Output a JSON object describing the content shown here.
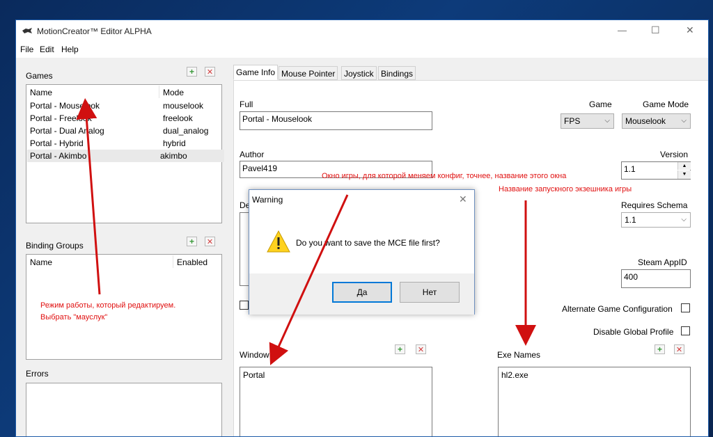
{
  "window": {
    "title": "MotionCreator™ Editor ALPHA",
    "controls": {
      "minimize": "—",
      "maximize": "☐",
      "close": "✕"
    }
  },
  "menu": {
    "items": [
      "File",
      "Edit",
      "Help"
    ]
  },
  "games": {
    "label": "Games",
    "columns": [
      "Name",
      "Mode"
    ],
    "rows": [
      {
        "name": "Portal - Mouselook",
        "mode": "mouselook"
      },
      {
        "name": "Portal - Freelook",
        "mode": "freelook"
      },
      {
        "name": "Portal - Dual Analog",
        "mode": "dual_analog"
      },
      {
        "name": "Portal - Hybrid",
        "mode": "hybrid"
      },
      {
        "name": "Portal - Akimbo",
        "mode": "akimbo"
      }
    ]
  },
  "binding_groups": {
    "label": "Binding Groups",
    "columns": [
      "Name",
      "Enabled"
    ]
  },
  "errors": {
    "label": "Errors"
  },
  "tabs": [
    "Game Info",
    "Mouse Pointer",
    "Joystick",
    "Bindings"
  ],
  "game_info": {
    "full_label": "Full",
    "full_value": "Portal - Mouselook",
    "game_label": "Game",
    "game_value": "FPS",
    "game_mode_label": "Game Mode",
    "game_mode_value": "Mouselook",
    "author_label": "Author",
    "author_value": "Pavel419",
    "version_label": "Version",
    "version_value": "1.1",
    "description_label_partial": "De",
    "requires_schema_label": "Requires Schema",
    "requires_schema_value": "1.1",
    "steam_appid_label": "Steam AppID",
    "steam_appid_value": "400",
    "alt_config_label": "Alternate Game Configuration",
    "disable_global_label": "Disable Global Profile",
    "window_label": "Window",
    "window_value": "Portal",
    "exe_label": "Exe Names",
    "exe_value": "hl2.exe"
  },
  "dialog": {
    "title": "Warning",
    "message": "Do you want to save the MCE file first?",
    "yes": "Да",
    "no": "Нет",
    "icon": "warning-icon"
  },
  "annotations": {
    "mode_note_line1": "Режим работы, который редактируем.",
    "mode_note_line2": "Выбрать \"мауслук\"",
    "window_note": "Окно игры, для которой меняем конфиг, точнее, название этого окна",
    "exe_note": "Название запускного экзешника игры"
  },
  "colors": {
    "annotation": "#e01010",
    "accent": "#0078d7",
    "add": "#3a9a3a",
    "remove": "#d43a3a"
  }
}
